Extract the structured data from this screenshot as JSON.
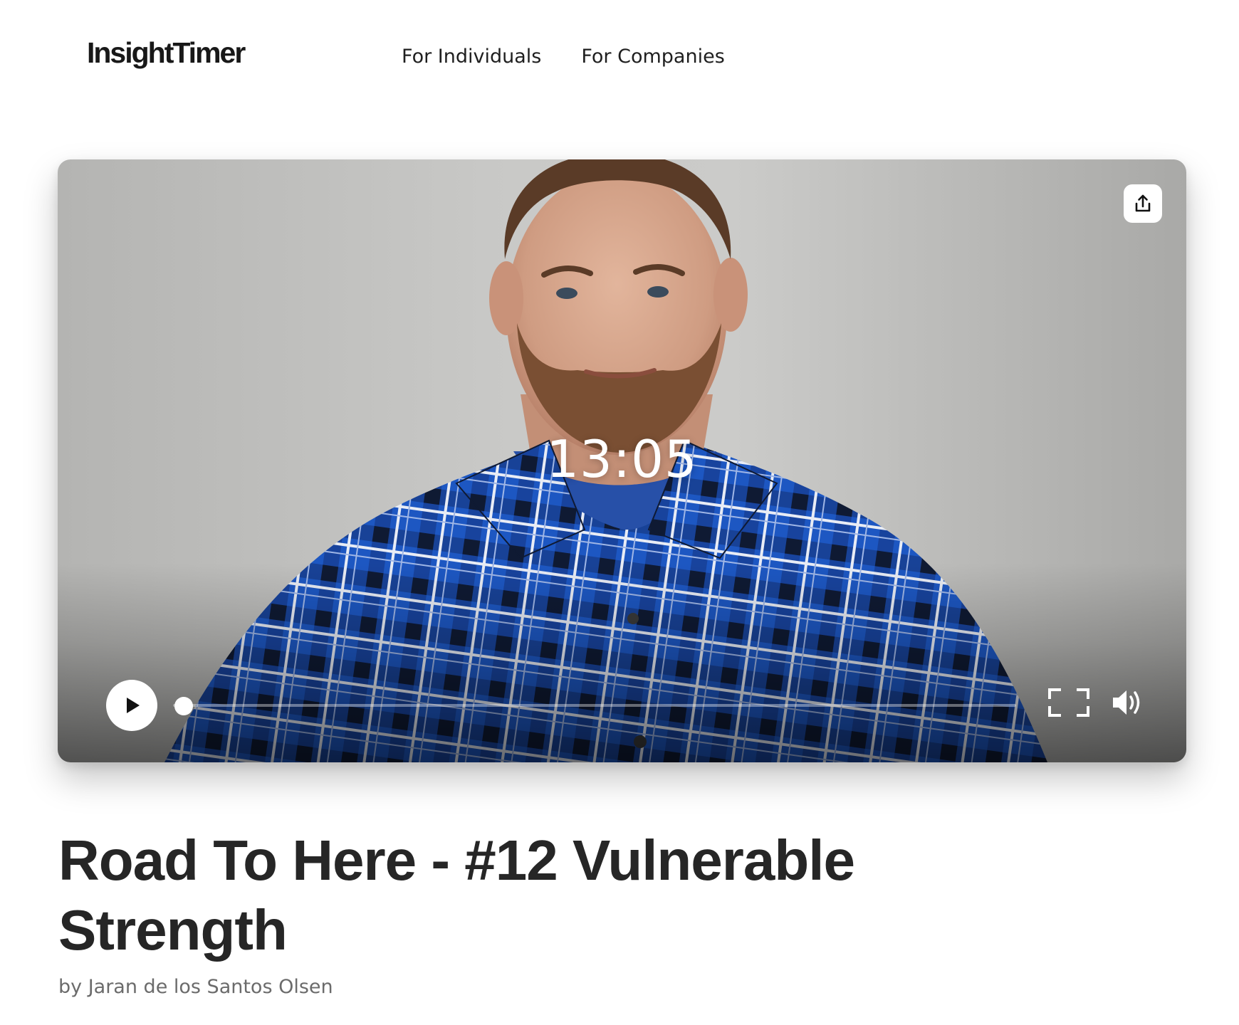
{
  "header": {
    "logo": "InsightTimer",
    "nav": [
      {
        "label": "For Individuals"
      },
      {
        "label": "For Companies"
      }
    ]
  },
  "player": {
    "timer": "13:05",
    "progress": 0,
    "icons": {
      "share": "share-icon",
      "play": "play-icon",
      "fullscreen": "fullscreen-icon",
      "volume": "volume-icon"
    }
  },
  "content": {
    "title": "Road To Here - #12 Vulnerable Strength",
    "author": "by Jaran de los Santos Olsen"
  }
}
